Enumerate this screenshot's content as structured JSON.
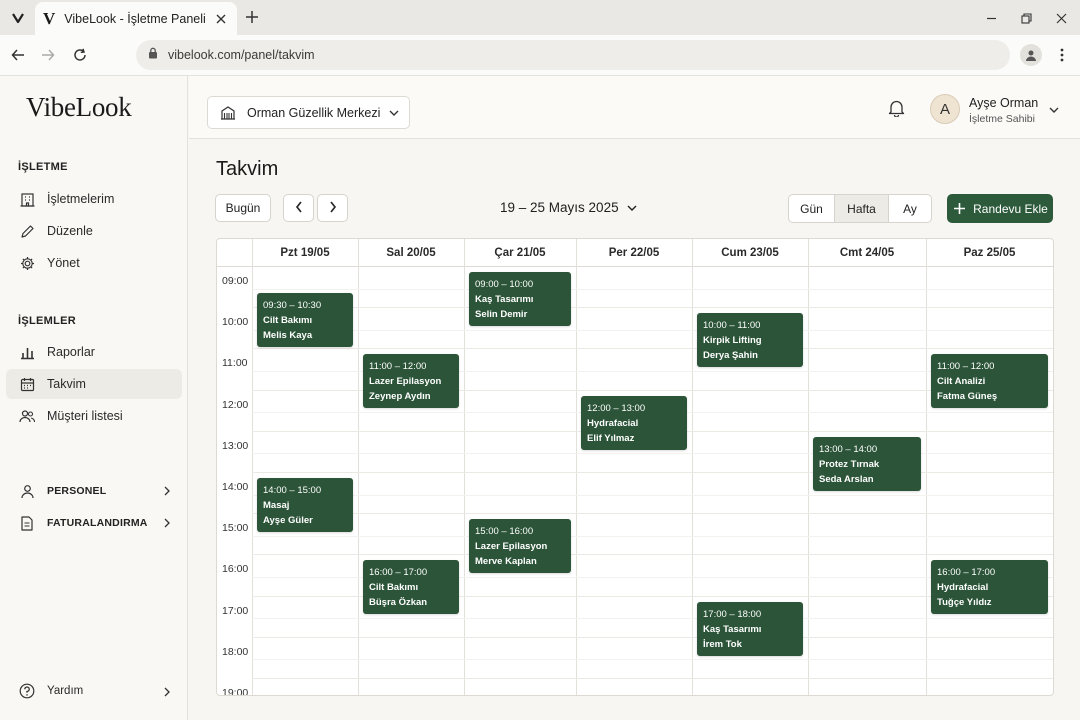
{
  "browser": {
    "tab_title": "VibeLook - İşletme Paneli",
    "tab_favicon": "V",
    "url": "vibelook.com/panel/takvim"
  },
  "sidebar": {
    "brand": "VibeLook",
    "section1": "İŞLETME",
    "items1": [
      {
        "label": "İşletmelerim",
        "icon": "building-icon"
      },
      {
        "label": "Düzenle",
        "icon": "pencil-icon"
      },
      {
        "label": "Yönet",
        "icon": "gear-icon"
      }
    ],
    "section2": "İŞLEMLER",
    "items2": [
      {
        "label": "Raporlar",
        "icon": "bar-chart-icon"
      },
      {
        "label": "Takvim",
        "icon": "calendar-icon"
      },
      {
        "label": "Müşteri listesi",
        "icon": "users-icon"
      }
    ],
    "groups": [
      {
        "label": "PERSONEL",
        "icon": "person-icon"
      },
      {
        "label": "FATURALANDIRMA",
        "icon": "invoice-icon"
      }
    ],
    "help": "Yardım"
  },
  "topbar": {
    "business": "Orman Güzellik Merkezi",
    "user_initial": "A",
    "user_name": "Ayşe Orman",
    "user_role": "İşletme Sahibi"
  },
  "page": {
    "title": "Takvim",
    "today": "Bugün",
    "date_range": "19 – 25 Mayıs 2025",
    "views": [
      "Gün",
      "Hafta",
      "Ay"
    ],
    "active_view": "Hafta",
    "add_button": "Randevu Ekle"
  },
  "calendar": {
    "days": [
      "Pzt 19/05",
      "Sal 20/05",
      "Çar 21/05",
      "Per 22/05",
      "Cum 23/05",
      "Cmt 24/05",
      "Paz 25/05"
    ],
    "hours": [
      "09:00",
      "10:00",
      "11:00",
      "12:00",
      "13:00",
      "14:00",
      "15:00",
      "16:00",
      "17:00",
      "18:00",
      "19:00"
    ],
    "appointments": [
      {
        "day": 0,
        "start": "09:30",
        "time": "09:30 – 10:30",
        "service": "Cilt Bakımı",
        "client": "Melis Kaya"
      },
      {
        "day": 0,
        "start": "14:00",
        "time": "14:00 – 15:00",
        "service": "Masaj",
        "client": "Ayşe Güler"
      },
      {
        "day": 1,
        "start": "11:00",
        "time": "11:00 – 12:00",
        "service": "Lazer Epilasyon",
        "client": "Zeynep Aydın"
      },
      {
        "day": 1,
        "start": "16:00",
        "time": "16:00 – 17:00",
        "service": "Cilt Bakımı",
        "client": "Büşra Özkan"
      },
      {
        "day": 2,
        "start": "09:00",
        "time": "09:00 – 10:00",
        "service": "Kaş Tasarımı",
        "client": "Selin Demir"
      },
      {
        "day": 2,
        "start": "15:00",
        "time": "15:00 – 16:00",
        "service": "Lazer Epilasyon",
        "client": "Merve Kaplan"
      },
      {
        "day": 3,
        "start": "12:00",
        "time": "12:00 – 13:00",
        "service": "Hydrafacial",
        "client": "Elif Yılmaz"
      },
      {
        "day": 4,
        "start": "10:00",
        "time": "10:00 – 11:00",
        "service": "Kirpik Lifting",
        "client": "Derya Şahin"
      },
      {
        "day": 4,
        "start": "17:00",
        "time": "17:00 – 18:00",
        "service": "Kaş Tasarımı",
        "client": "İrem Tok"
      },
      {
        "day": 5,
        "start": "13:00",
        "time": "13:00 – 14:00",
        "service": "Protez Tırnak",
        "client": "Seda Arslan"
      },
      {
        "day": 6,
        "start": "11:00",
        "time": "11:00 – 12:00",
        "service": "Cilt Analizi",
        "client": "Fatma Güneş"
      },
      {
        "day": 6,
        "start": "16:00",
        "time": "16:00 – 17:00",
        "service": "Hydrafacial",
        "client": "Tuğçe Yıldız"
      }
    ]
  },
  "colors": {
    "accent": "#2c5a3b",
    "appointment": "#2b5438",
    "background": "#f7f6f2"
  }
}
